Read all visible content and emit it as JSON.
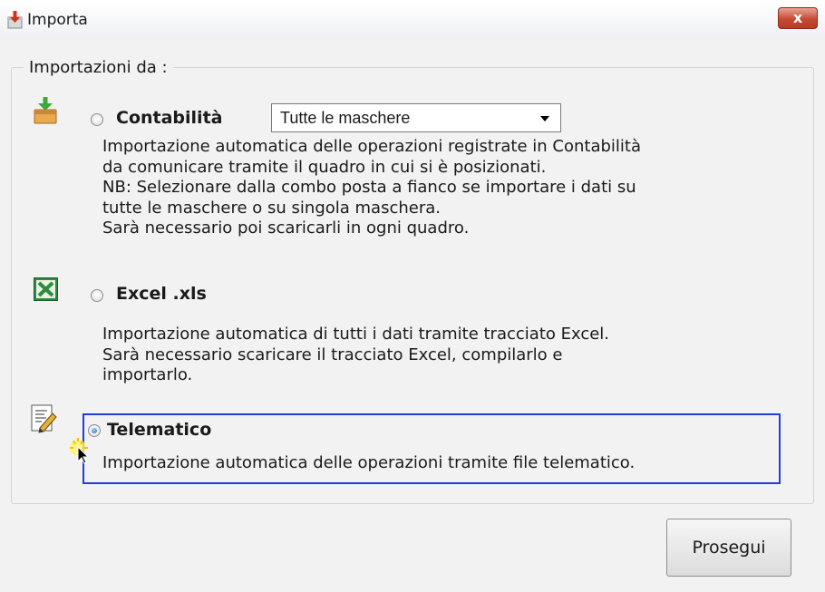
{
  "window": {
    "title": "Importa",
    "close_label": "x"
  },
  "group": {
    "legend": "Importazioni  da :"
  },
  "options": {
    "contabilita": {
      "label": "Contabilità",
      "checked": false,
      "icon": "download-box-icon",
      "combo_value": "Tutte le maschere",
      "description": [
        "Importazione automatica delle operazioni registrate in Contabilità",
        "da comunicare tramite il quadro in cui si è posizionati.",
        "NB: Selezionare dalla combo posta a fianco se importare i dati su",
        "tutte le maschere o su singola maschera.",
        "Sarà necessario poi scaricarli in ogni quadro."
      ]
    },
    "excel": {
      "label": "Excel .xls",
      "checked": false,
      "icon": "excel-icon",
      "description": [
        "Importazione automatica di tutti i dati tramite tracciato Excel.",
        "Sarà necessario scaricare il tracciato Excel, compilarlo e",
        "importarlo."
      ]
    },
    "telematico": {
      "label": "Telematico",
      "checked": true,
      "icon": "document-pencil-icon",
      "description": [
        "Importazione automatica delle operazioni tramite file telematico."
      ]
    }
  },
  "buttons": {
    "proceed_label": "Prosegui"
  },
  "colors": {
    "focus_border": "#1f3fd8",
    "close_button": "#c64a33",
    "excel_green": "#2f8a3a"
  }
}
